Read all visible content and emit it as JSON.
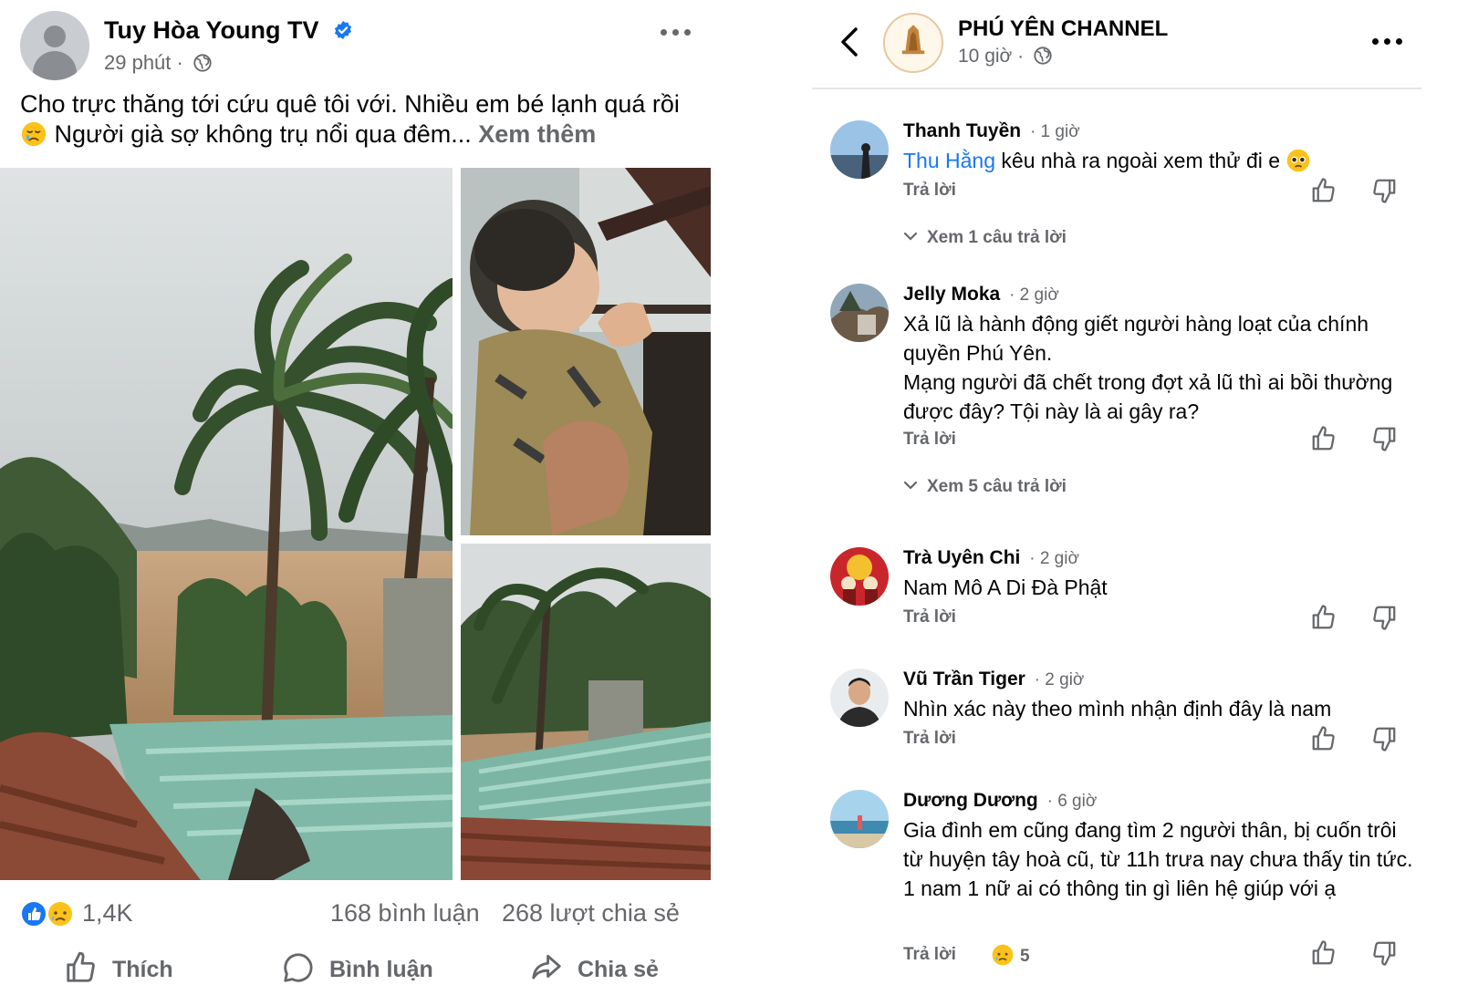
{
  "post": {
    "author": "Tuy Hòa Young TV",
    "time": "29 phút",
    "text": "Cho trực thăng tới cứu quê tôi với. Nhiều em bé lạnh quá rồi",
    "text_cont": "Người già sợ không trụ nổi qua đêm...",
    "see_more": "Xem thêm",
    "reactions_count": "1,4K",
    "comments_count": "168 bình luận",
    "shares_count": "268 lượt chia sẻ",
    "actions": {
      "like": "Thích",
      "comment": "Bình luận",
      "share": "Chia sẻ"
    }
  },
  "comments_panel": {
    "page_name": "PHÚ YÊN CHANNEL",
    "time": "10 giờ",
    "reply_label": "Trả lời",
    "comments": [
      {
        "name": "Thanh Tuyền",
        "time": "· 1 giờ",
        "mention": "Thu Hằng",
        "text": "kêu nhà ra ngoài xem thử đi e",
        "view_replies": "Xem 1 câu trả lời"
      },
      {
        "name": "Jelly Moka",
        "time": "· 2 giờ",
        "text": "Xả lũ là hành động giết người hàng loạt của chính quyền Phú Yên.",
        "text2": "Mạng người đã chết trong đợt xả lũ thì ai bồi thường được đây? Tội này là ai gây ra?",
        "view_replies": "Xem 5 câu trả lời"
      },
      {
        "name": "Trà Uyên Chi",
        "time": "· 2 giờ",
        "text": "Nam Mô A Di Đà Phật"
      },
      {
        "name": "Vũ Trần Tiger",
        "time": "· 2 giờ",
        "text": "Nhìn xác này theo mình nhận định đây là nam"
      },
      {
        "name": "Dương Dương",
        "time": "· 6 giờ",
        "text": "Gia đình em cũng đang tìm 2 người thân, bị cuốn trôi từ huyện tây hoà cũ, từ 11h trưa nay chưa thấy tin tức. 1 nam 1 nữ ai có thông tin gì liên hệ giúp với ạ",
        "reaction_count": "5"
      }
    ]
  },
  "icons": {
    "verified": "verified-badge-icon",
    "globe": "globe-icon",
    "like_reaction": "like-reaction-icon",
    "sad_reaction": "sad-reaction-icon",
    "thumbs_up": "thumbs-up-icon",
    "thumbs_down": "thumbs-down-icon",
    "back": "chevron-left-icon",
    "more": "more-dots-icon"
  },
  "colors": {
    "facebook_blue": "#1877f2",
    "secondary_text": "#65676b",
    "primary_text": "#050505"
  }
}
